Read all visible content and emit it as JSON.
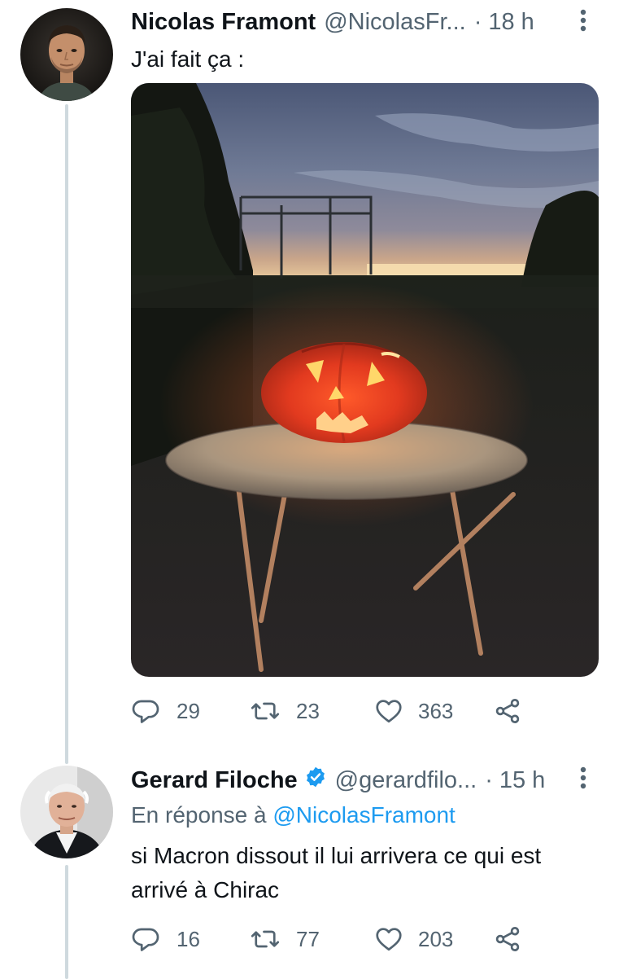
{
  "tweets": [
    {
      "author": {
        "display_name": "Nicolas Framont",
        "handle": "@NicolasFr...",
        "avatar": "avatar-nicolas",
        "verified": false
      },
      "separator": "·",
      "timestamp": "18 h",
      "text": "J'ai fait ça :",
      "media": {
        "type": "photo",
        "subject": "carved-pumpkin-on-garden-table-at-dusk"
      },
      "actions": {
        "replies": "29",
        "retweets": "23",
        "likes": "363"
      },
      "icons": [
        "reply-icon",
        "retweet-icon",
        "like-icon",
        "share-icon",
        "more-icon"
      ]
    },
    {
      "author": {
        "display_name": "Gerard Filoche",
        "handle": "@gerardfilo...",
        "avatar": "avatar-gerard",
        "verified": true
      },
      "separator": "·",
      "timestamp": "15 h",
      "reply_to": {
        "prefix": "En réponse à",
        "mention": "@NicolasFramont"
      },
      "text_lines": [
        "si Macron dissout il lui arrivera ce qui est",
        "arrivé à Chirac"
      ],
      "actions": {
        "replies": "16",
        "retweets": "77",
        "likes": "203"
      },
      "icons": [
        "reply-icon",
        "retweet-icon",
        "like-icon",
        "share-icon",
        "more-icon",
        "verified-badge-icon"
      ]
    }
  ],
  "colors": {
    "text_primary": "#0f1419",
    "text_secondary": "#536471",
    "link": "#1d9bf0",
    "thread_line": "#cfd9de",
    "verified": "#1d9bf0"
  }
}
